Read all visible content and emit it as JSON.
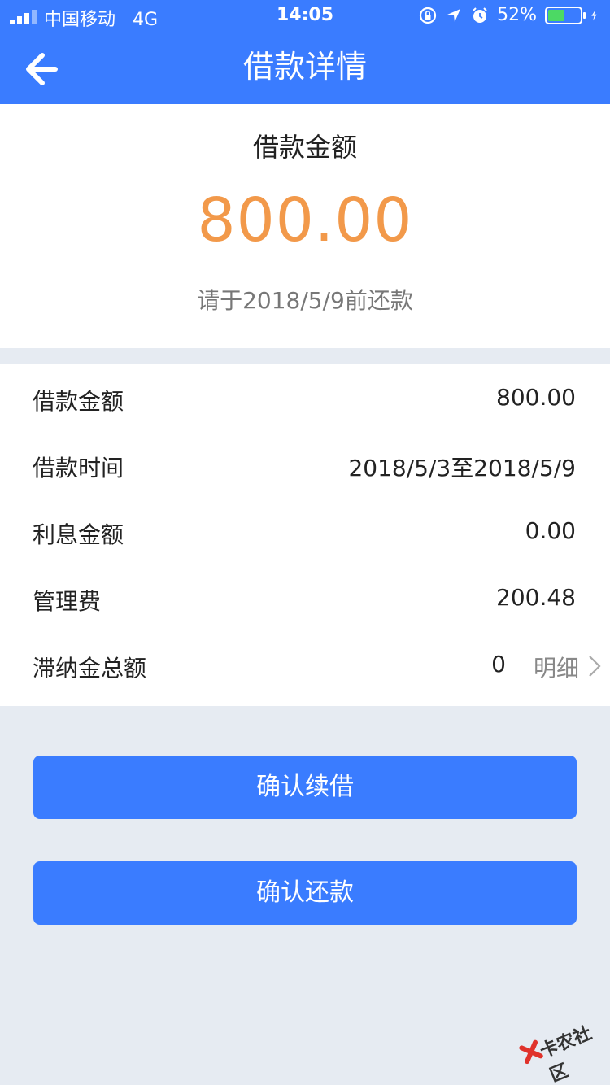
{
  "status_bar": {
    "carrier": "中国移动",
    "network": "4G",
    "time": "14:05",
    "battery_percent": "52%",
    "battery_level": 0.52,
    "icons": [
      "signal-icon",
      "rotation-lock-icon",
      "location-icon",
      "alarm-icon",
      "battery-icon",
      "charging-icon"
    ]
  },
  "nav": {
    "title": "借款详情",
    "back_icon": "back-arrow-icon"
  },
  "summary": {
    "label": "借款金额",
    "amount": "800.00",
    "due_text": "请于2018/5/9前还款"
  },
  "details": [
    {
      "label": "借款金额",
      "value": "800.00"
    },
    {
      "label": "借款时间",
      "value": "2018/5/3至2018/5/9"
    },
    {
      "label": "利息金额",
      "value": "0.00"
    },
    {
      "label": "管理费",
      "value": "200.48"
    },
    {
      "label": "滞纳金总额",
      "value": "0",
      "link": "明细"
    }
  ],
  "buttons": {
    "renew": "确认续借",
    "repay": "确认还款"
  },
  "watermark": "卡农社区",
  "colors": {
    "primary": "#3a7cff",
    "amount": "#f2994a",
    "background": "#e6ebf2",
    "battery_fill": "#4cd964"
  }
}
